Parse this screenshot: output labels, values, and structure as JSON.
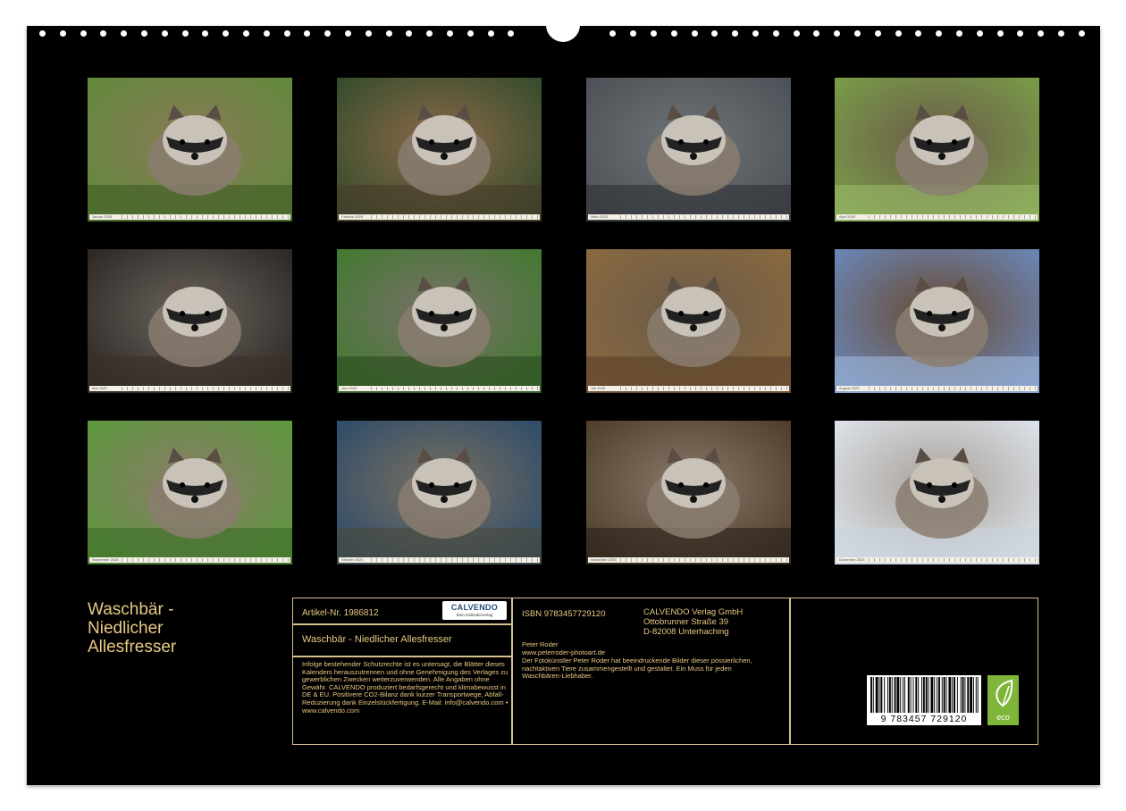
{
  "calendar": {
    "title_lines": [
      "Waschbär -",
      "Niedlicher",
      "Allesfresser"
    ],
    "months": [
      {
        "label": "Januar 2025",
        "palette": [
          "#5f8a3a",
          "#8a7a58",
          "#3e5a24"
        ]
      },
      {
        "label": "Februar 2025",
        "palette": [
          "#2f4a2a",
          "#8c6a4a",
          "#4a3a2a"
        ]
      },
      {
        "label": "März 2025",
        "palette": [
          "#4a4f55",
          "#6e7477",
          "#2e3236"
        ]
      },
      {
        "label": "April 2025",
        "palette": [
          "#7aa048",
          "#6b5a4a",
          "#9ab86a"
        ]
      },
      {
        "label": "Mai 2025",
        "palette": [
          "#2a2420",
          "#6b6560",
          "#3a302a"
        ]
      },
      {
        "label": "Juni 2025",
        "palette": [
          "#3f7a2e",
          "#7a706a",
          "#2a4a20"
        ]
      },
      {
        "label": "Juli 2025",
        "palette": [
          "#8a6a40",
          "#6b5a48",
          "#5a4028"
        ]
      },
      {
        "label": "August 2025",
        "palette": [
          "#6a8ac0",
          "#6a4a30",
          "#a0b8d8"
        ]
      },
      {
        "label": "September 2025",
        "palette": [
          "#5a9a3a",
          "#8a7a6a",
          "#3a6a28"
        ]
      },
      {
        "label": "Oktober 2025",
        "palette": [
          "#2a4a6a",
          "#7a7060",
          "#4a4a3a"
        ]
      },
      {
        "label": "November 2025",
        "palette": [
          "#4a3a28",
          "#8a7a6a",
          "#2a2018"
        ]
      },
      {
        "label": "Dezember 2025",
        "palette": [
          "#dfe6ee",
          "#a8a098",
          "#c8d2dc"
        ]
      }
    ]
  },
  "info": {
    "article": "Artikel-Nr. 1986812",
    "logo_name": "CALVENDO",
    "logo_tagline": "Dein Kalenderverlag",
    "product_title": "Waschbär - Niedlicher Allesfresser",
    "legal_text": "Infolge bestehender Schutzrechte ist es untersagt, die Blätter dieses Kalenders herauszutrennen und ohne Genehmigung des Verlages zu gewerblichen Zwecken weiterzuverwenden. Alle Angaben ohne Gewähr. CALVENDO produziert bedarfsgerecht und klimabewusst in DE & EU. Positivere CO2-Bilanz dank kurzer Transportwege, Abfall-Reduzierung dank Einzelstückfertigung. E-Mail: info@calvendo.com • www.calvendo.com",
    "isbn": "ISBN 9783457729120",
    "publisher_lines": [
      "CALVENDO Verlag GmbH",
      "Ottobrunner Straße 39",
      "D-82008 Unterhaching"
    ],
    "author": "Peter Roder",
    "author_url": "www.peterroder-photoart.de",
    "description": "Der Fotokünstler Peter Roder hat beeindruckende Bilder dieser possierlichen, nachtaktiven Tiere zusammengestellt und gestaltet. Ein Muss für jeden Waschbären-Liebhaber.",
    "barcode_digits": "9 783457 729120",
    "eco_label": "eco"
  }
}
